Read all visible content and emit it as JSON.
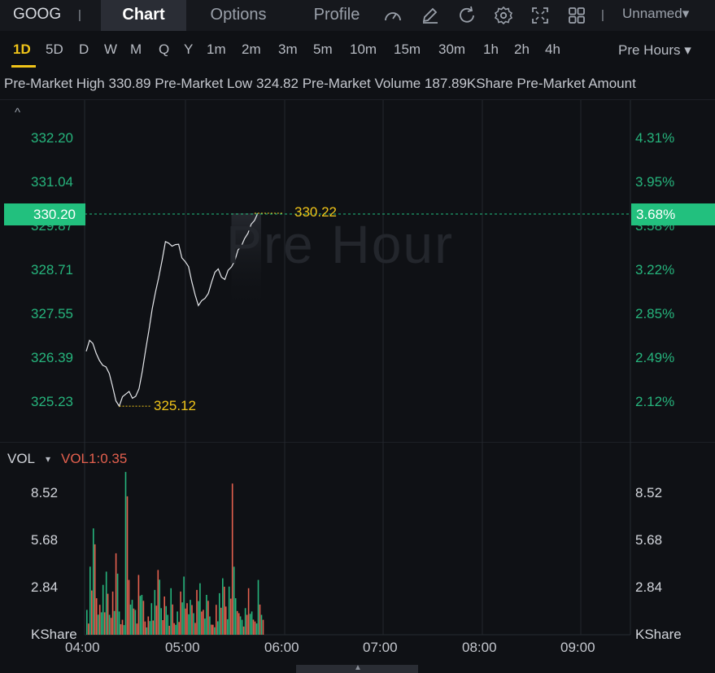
{
  "header": {
    "symbol": "GOOG",
    "separator": "|",
    "tabs": [
      {
        "label": "Chart",
        "active": true
      },
      {
        "label": "Options",
        "active": false
      },
      {
        "label": "Profile",
        "active": false
      }
    ],
    "toolbar_icons": [
      "gauge-icon",
      "draw-icon",
      "refresh-icon",
      "settings-icon",
      "fullscreen-icon",
      "grid-layout-icon"
    ],
    "layout_select": "Unnamed",
    "layout_caret": "▾"
  },
  "intervals": {
    "items": [
      "1D",
      "5D",
      "D",
      "W",
      "M",
      "Q",
      "Y",
      "1m",
      "2m",
      "3m",
      "5m",
      "10m",
      "15m",
      "30m",
      "1h",
      "2h",
      "4h"
    ],
    "active": "1D",
    "session_select": "Pre Hours",
    "session_caret": "▾"
  },
  "premarket_info": {
    "high_label": "Pre-Market High",
    "high_value": "330.89",
    "low_label": "Pre-Market Low",
    "low_value": "324.82",
    "volume_label": "Pre-Market Volume",
    "volume_value": "187.89KShare",
    "amount_label": "Pre-Market Amount"
  },
  "price_chart": {
    "collapse_chevron": "^",
    "watermark": "Pre Hour",
    "price_ticks": [
      "332.20",
      "331.04",
      "329.87",
      "328.71",
      "327.55",
      "326.39",
      "325.23"
    ],
    "percent_ticks": [
      "4.31%",
      "3.95%",
      "3.58%",
      "3.22%",
      "2.85%",
      "2.49%",
      "2.12%"
    ],
    "current_price": "330.20",
    "current_percent": "3.68%",
    "high_marker": "330.22",
    "low_marker": "325.12",
    "colors": {
      "up": "#26b47c",
      "down": "#e4604e",
      "marker": "#f0c419",
      "current_bg": "#22c07e"
    }
  },
  "volume_chart": {
    "title": "VOL",
    "caret": "▾",
    "indicator": "VOL1:0.35",
    "ticks": [
      "8.52",
      "5.68",
      "2.84"
    ],
    "unit": "KShare"
  },
  "time_axis": [
    "04:00",
    "05:00",
    "06:00",
    "07:00",
    "08:00",
    "09:00"
  ],
  "chart_data": {
    "type": "line",
    "title": "",
    "xlabel": "",
    "ylabel": "",
    "ylim": [
      324.82,
      332.79
    ],
    "x": [
      "04:00",
      "04:02",
      "04:04",
      "04:06",
      "04:08",
      "04:10",
      "04:12",
      "04:14",
      "04:16",
      "04:18",
      "04:20",
      "04:22",
      "04:24",
      "04:26",
      "04:28",
      "04:30",
      "04:32",
      "04:34",
      "04:36",
      "04:38",
      "04:40",
      "04:42",
      "04:44",
      "04:46",
      "04:48",
      "04:50",
      "04:52",
      "04:54",
      "04:56",
      "04:58",
      "05:00",
      "05:02",
      "05:04",
      "05:06",
      "05:08",
      "05:10",
      "05:12",
      "05:14",
      "05:16",
      "05:18",
      "05:20",
      "05:22",
      "05:24",
      "05:26",
      "05:28",
      "05:30",
      "05:32",
      "05:34",
      "05:36",
      "05:38",
      "05:40",
      "05:42",
      "05:44",
      "05:46",
      "05:48",
      "05:50",
      "05:52",
      "05:54",
      "05:56",
      "05:58"
    ],
    "series": [
      {
        "values": [
          326.57,
          326.86,
          326.78,
          326.52,
          326.33,
          326.2,
          326.16,
          325.98,
          325.63,
          325.26,
          325.12,
          325.37,
          325.44,
          325.51,
          325.33,
          325.38,
          325.58,
          326.05,
          326.6,
          327.13,
          327.69,
          328.14,
          328.53,
          328.98,
          329.47,
          329.43,
          329.35,
          329.39,
          329.4,
          329.04,
          328.94,
          328.81,
          328.41,
          328.06,
          327.78,
          327.91,
          327.97,
          328.1,
          328.4,
          328.66,
          328.75,
          328.53,
          328.47,
          328.71,
          328.8,
          328.96,
          329.25,
          329.35,
          329.55,
          329.69,
          329.93,
          330.03,
          330.22,
          330.2,
          330.2,
          330.2,
          330.2,
          330.2,
          330.2,
          330.2
        ]
      }
    ]
  },
  "volume_data": {
    "type": "bar",
    "unit": "KShare",
    "values": [
      1.5,
      4.1,
      6.4,
      2.2,
      1.8,
      3.0,
      3.8,
      1.2,
      2.6,
      4.9,
      1.4,
      0.9,
      9.8,
      3.3,
      2.1,
      1.5,
      3.6,
      2.4,
      0.8,
      1.1,
      1.9,
      2.7,
      3.9,
      1.6,
      2.3,
      1.2,
      2.8,
      0.7,
      1.4,
      2.6,
      3.5,
      1.9,
      2.1,
      1.3,
      2.7,
      3.1,
      1.5,
      2.4,
      1.1,
      0.6,
      1.8,
      2.5,
      3.4,
      1.7,
      2.9,
      9.1,
      2.2,
      1.3,
      0.9,
      1.6,
      2.8,
      1.4,
      0.8,
      3.3,
      1.2,
      0.7,
      2.6,
      1.1,
      4.5,
      1.8
    ],
    "up": [
      true,
      true,
      true,
      false,
      false,
      true,
      true,
      true,
      false,
      false,
      true,
      false,
      true,
      false,
      true,
      true,
      false,
      true,
      false,
      false,
      true,
      true,
      false,
      true,
      false,
      true,
      true,
      false,
      true,
      false,
      true,
      false,
      true,
      true,
      false,
      true,
      false,
      true,
      true,
      false,
      false,
      true,
      true,
      false,
      true,
      false,
      true,
      false,
      true,
      true,
      false,
      true,
      false,
      true,
      true,
      false,
      true,
      true,
      false,
      true
    ]
  }
}
